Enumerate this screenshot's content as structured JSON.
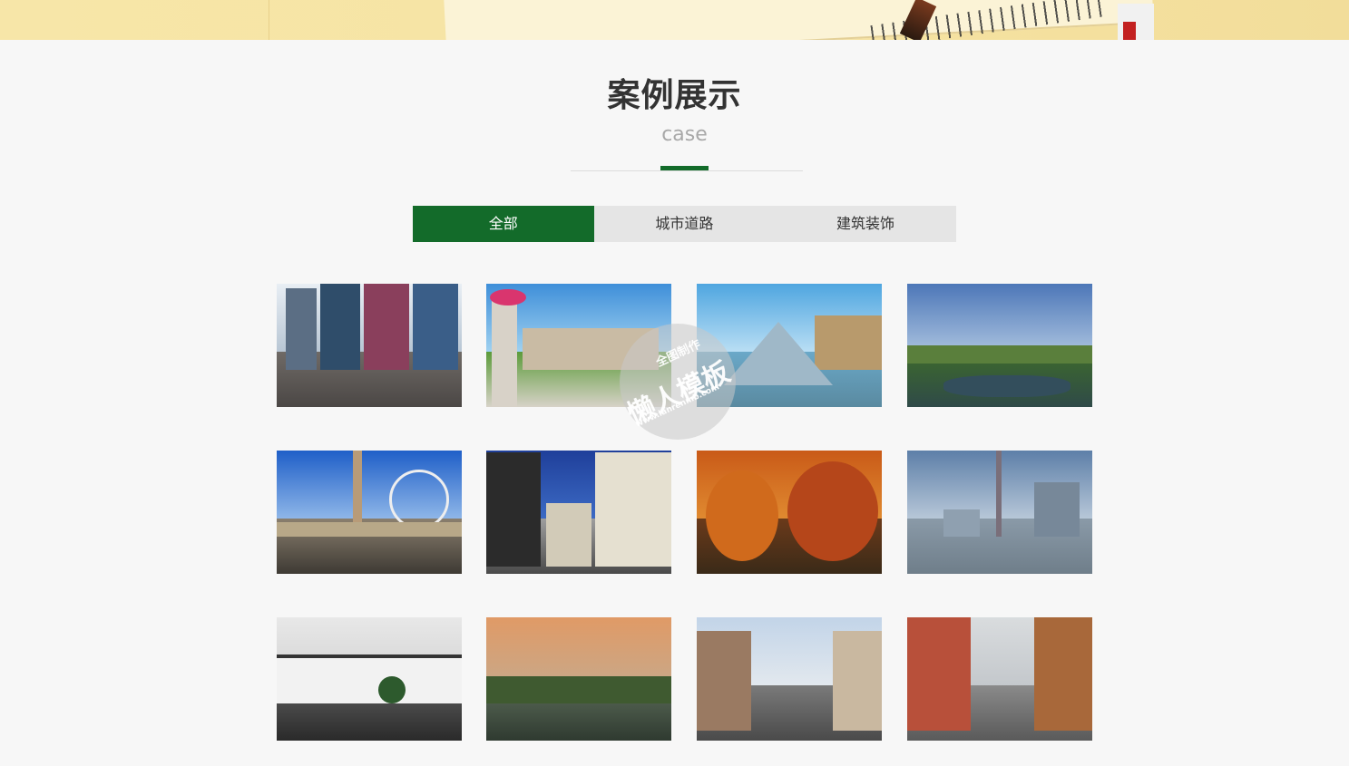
{
  "section": {
    "title": "案例展示",
    "subtitle": "case",
    "accent_color": "#136b2a"
  },
  "tabs": [
    {
      "label": "全部",
      "active": true
    },
    {
      "label": "城市道路",
      "active": false
    },
    {
      "label": "建筑装饰",
      "active": false
    }
  ],
  "cases": [
    {
      "subject": "times-square-billboards"
    },
    {
      "subject": "palace-garden-statue"
    },
    {
      "subject": "glass-pyramid-museum"
    },
    {
      "subject": "park-lake-skyline"
    },
    {
      "subject": "obelisk-ferris-wheel"
    },
    {
      "subject": "city-street-skyscrapers"
    },
    {
      "subject": "autumn-trees-park"
    },
    {
      "subject": "tv-tower-riverside-skyline"
    },
    {
      "subject": "white-wall-garden-pond"
    },
    {
      "subject": "lakeside-sunset-trees"
    },
    {
      "subject": "european-street-cars"
    },
    {
      "subject": "shopping-street-signs"
    }
  ],
  "watermark": {
    "line1": "全图制作",
    "line2": "懒人模板",
    "line3": "www.lanrenmb.com"
  }
}
